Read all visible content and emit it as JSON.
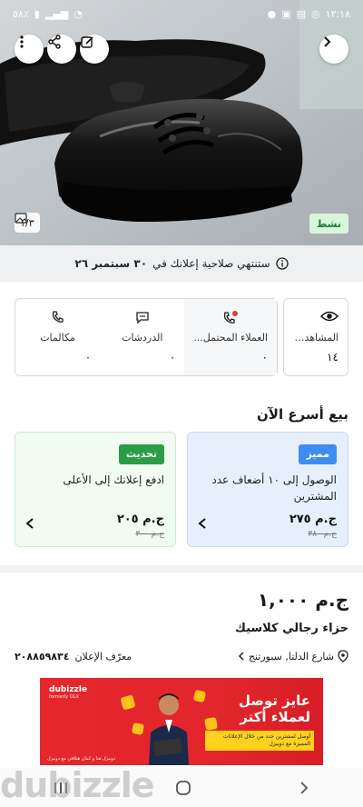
{
  "status_bar": {
    "time": "١٢:١٨",
    "battery": "٥٨٪"
  },
  "hero": {
    "image_counter": "١/٣",
    "active_label": "نشط"
  },
  "expiry": {
    "text": "ستنتهي صلاحية إعلانك في",
    "date": "٣٠ سبتمبر ٢٦"
  },
  "stats": {
    "views": {
      "label": "المشاهدات",
      "value": "١٤"
    },
    "leads": {
      "label": "العملاء المحتمل...",
      "value": "٠"
    },
    "chats": {
      "label": "الدردشات",
      "value": "٠"
    },
    "calls": {
      "label": "مكالمات",
      "value": "٠"
    }
  },
  "sell_faster": {
    "title": "بيع أسرع الآن",
    "featured": {
      "tag": "مميز",
      "description": "الوصول إلى ١٠ أضعاف عدد المشترين",
      "price": "ج.م ٢٧٥",
      "old_price": "ج.م ٣٨٠"
    },
    "refresh": {
      "tag": "تحديث",
      "description": "ادفع إعلانك إلى الأعلى",
      "price": "ج.م ٢٠٥",
      "old_price": "ج.م ٣٠٠"
    }
  },
  "listing": {
    "price": "ج.م ١,٠٠٠",
    "title": "حزاء رجالي كلاسيك",
    "location": "شارع الدلتا, سبورتنج",
    "ad_id_label": "معرّف الإعلان",
    "ad_id": "٢٠٨٨٥٩٨٣٤"
  },
  "banner": {
    "logo": "dubizzle",
    "logo_sub": "formerly OLX",
    "headline_1": "عايز توصل",
    "headline_2": "لعملاء أكتر",
    "sub_text": "أوصل لمشترين جدد من خلال الإعلانات المميزة مع دوبيزل",
    "footer": "دوبيزل هنا و كمان هتلاقي مع دوبيزل"
  },
  "watermark": "dubizzle",
  "colors": {
    "featured_tag": "#3e8ef0",
    "refresh_tag": "#2a9d46",
    "banner_red": "#e5272d",
    "banner_yellow": "#ffd21f"
  }
}
